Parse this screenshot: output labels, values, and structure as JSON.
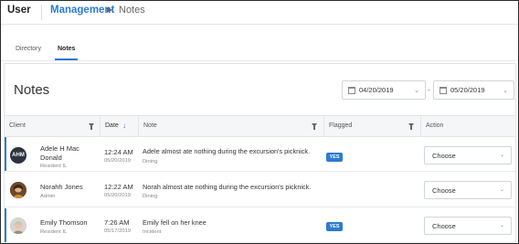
{
  "header": {
    "app_title": "User",
    "breadcrumb": [
      "Management",
      "Notes"
    ]
  },
  "tabs": [
    {
      "label": "Directory",
      "active": false
    },
    {
      "label": "Notes",
      "active": true
    }
  ],
  "page": {
    "title": "Notes",
    "date_from": "04/20/2019",
    "date_to": "05/20/2019",
    "date_separator": "-"
  },
  "table": {
    "columns": [
      "Client",
      "Date",
      "Note",
      "Flagged",
      "Action"
    ],
    "rows": [
      {
        "client_name": "Adele H Mac Donald",
        "client_sub": "Resident IL",
        "avatar_initials": "AHM",
        "avatar_color": "#2b3340",
        "time": "12:24 AM",
        "date": "05/20/2019",
        "note": "Adele almost ate nothing during the excursion's picknick.",
        "category": "Dining",
        "flagged": "YES",
        "action": "Choose",
        "accent": true
      },
      {
        "client_name": "Norahh Jones",
        "client_sub": "Admin",
        "avatar_initials": "",
        "avatar_color": "#c9803a",
        "time": "12:22 AM",
        "date": "05/20/2019",
        "note": "Norah almost ate nothing during the excursion's picknick.",
        "category": "Dining",
        "flagged": "",
        "action": "Choose",
        "accent": false
      },
      {
        "client_name": "Emily Thomson",
        "client_sub": "Resident IL",
        "avatar_initials": "",
        "avatar_color": "#b8a89a",
        "time": "7:26 AM",
        "date": "05/17/2019",
        "note": "Emily fell on her knee",
        "category": "Incident",
        "flagged": "YES",
        "action": "Choose",
        "accent": true
      }
    ]
  },
  "colors": {
    "accent": "#2b7bd4",
    "header_bg": "#f4f6f8"
  }
}
